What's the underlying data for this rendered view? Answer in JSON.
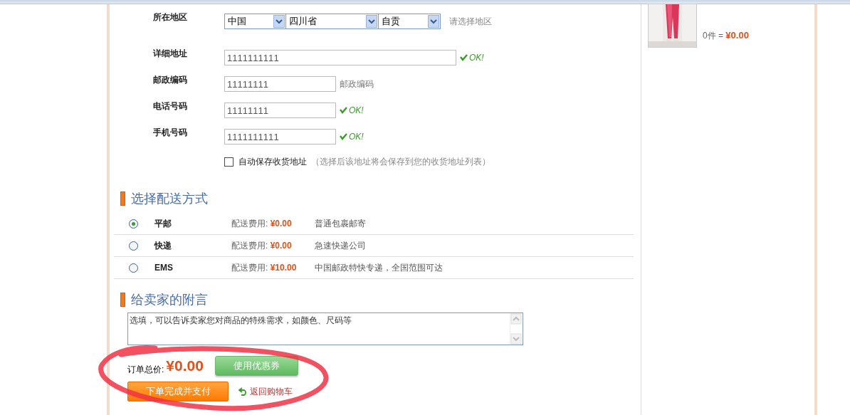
{
  "region": {
    "label": "所在地区",
    "dropdowns": [
      "中国",
      "四川省",
      "自贡"
    ],
    "hint": "请选择地区"
  },
  "fields": [
    {
      "label": "详细地址",
      "value": "1111111111",
      "wide": true,
      "status": {
        "kind": "ok",
        "text": "OK!"
      }
    },
    {
      "label": "邮政编码",
      "value": "11111111",
      "wide": false,
      "status": {
        "kind": "hint",
        "text": "邮政编码"
      }
    },
    {
      "label": "电话号码",
      "value": "11111111",
      "wide": false,
      "status": {
        "kind": "ok",
        "text": "OK!"
      }
    },
    {
      "label": "手机号码",
      "value": "1111111111",
      "wide": false,
      "status": {
        "kind": "ok",
        "text": "OK!"
      }
    }
  ],
  "save_address": {
    "label": "自动保存收货地址",
    "note": "（选择后该地址将会保存到您的收货地址列表）",
    "checked": false
  },
  "shipping": {
    "title": "选择配送方式",
    "options": [
      {
        "name": "平邮",
        "fee_label": "配送费用:",
        "fee": "¥0.00",
        "description": "普通包裹邮寄",
        "selected": true
      },
      {
        "name": "快递",
        "fee_label": "配送费用:",
        "fee": "¥0.00",
        "description": "急速快递公司",
        "selected": false
      },
      {
        "name": "EMS",
        "fee_label": "配送费用:",
        "fee": "¥10.00",
        "description": "中国邮政特快专递，全国范围可达",
        "selected": false
      }
    ]
  },
  "message": {
    "title": "给卖家的附言",
    "value": "选填，可以告诉卖家您对商品的特殊需求，如颜色、尺码等"
  },
  "total": {
    "label": "订单总价:",
    "amount": "¥0.00"
  },
  "coupon_button": "使用优惠券",
  "submit_button": "下单完成并支付",
  "back_link": "返回购物车",
  "cart_item": {
    "summary": "0件 =",
    "price": "¥0.00"
  }
}
